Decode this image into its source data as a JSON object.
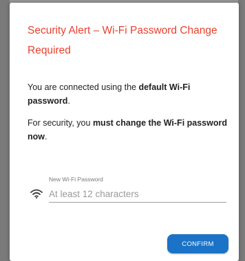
{
  "dialog": {
    "title": "Security Alert – Wi-Fi Password Change Required",
    "para1": {
      "prefix": "You are connected using the ",
      "bold": "default Wi-Fi password",
      "suffix": "."
    },
    "para2": {
      "prefix": "For security, you ",
      "bold": "must change the Wi-Fi password now",
      "suffix": "."
    },
    "password_field": {
      "label": "New Wi-Fi Password",
      "placeholder": "At least 12 characters",
      "value": "",
      "icon": "wifi-icon"
    },
    "confirm_label": "CONFIRM"
  },
  "colors": {
    "title": "#e8412f",
    "button": "#1a73c7",
    "backdrop": "#6f6f6f"
  }
}
